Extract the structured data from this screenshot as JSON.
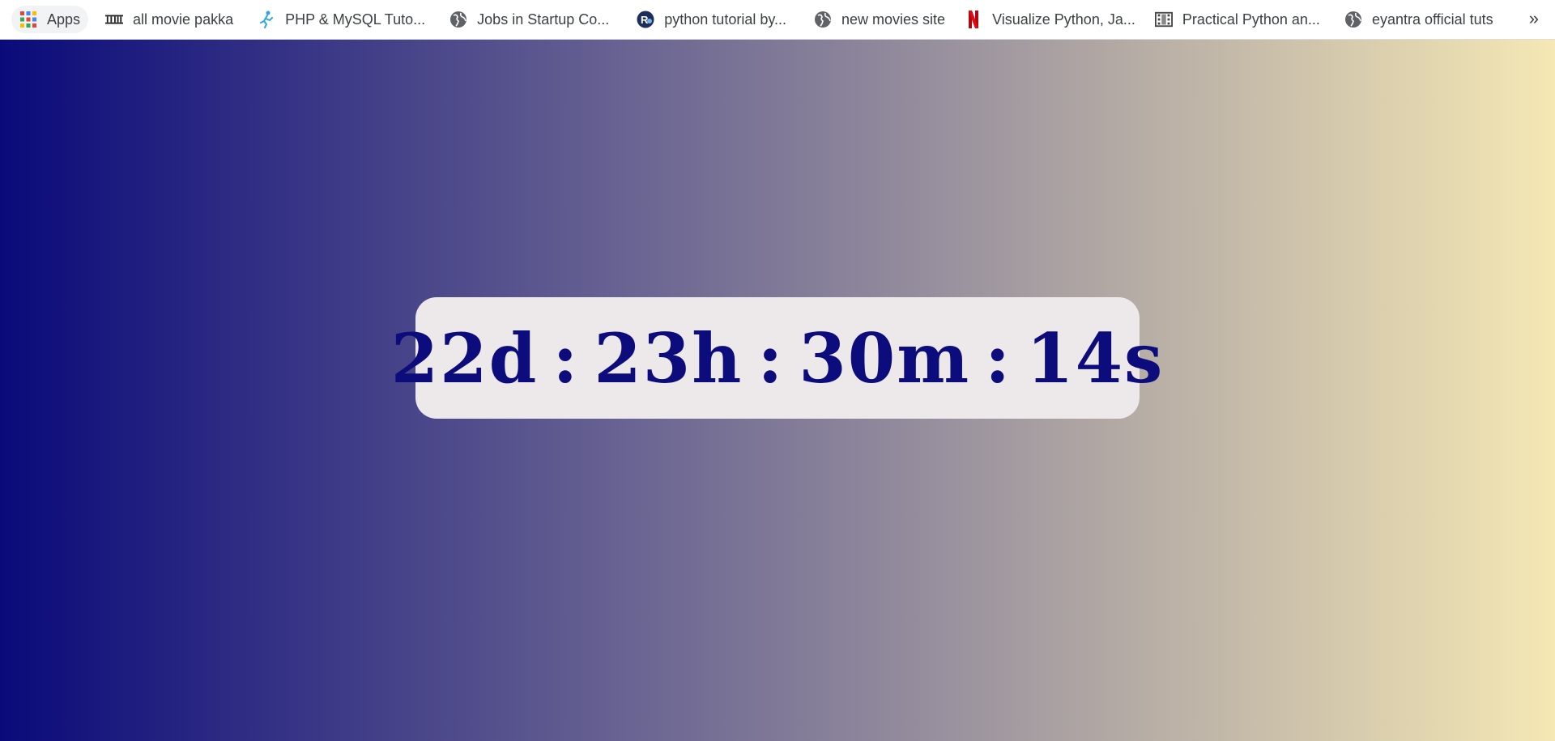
{
  "bookmarks_bar": {
    "apps": {
      "label": "Apps",
      "icon": "apps-grid-icon"
    },
    "items": [
      {
        "label": "all movie pakka",
        "icon": "movie-site-logo-icon"
      },
      {
        "label": "PHP & MySQL Tuto...",
        "icon": "runner-icon"
      },
      {
        "label": "Jobs in Startup Co...",
        "icon": "globe-icon"
      },
      {
        "label": "python tutorial by...",
        "icon": "r-logo-icon"
      },
      {
        "label": "new movies site",
        "icon": "globe-icon"
      },
      {
        "label": "Visualize Python, Ja...",
        "icon": "netflix-icon"
      },
      {
        "label": "Practical Python an...",
        "icon": "film-reel-icon"
      },
      {
        "label": "eyantra official tuts",
        "icon": "globe-icon"
      }
    ],
    "overflow_label": "»"
  },
  "page": {
    "gradient": {
      "start": "#0a0a7a",
      "end": "#f5e8b5"
    },
    "countdown": {
      "days": "22d",
      "hours": "23h",
      "minutes": "30m",
      "seconds": "14s",
      "separator": ":",
      "text_color": "#0c0c7c",
      "card_color": "#ede8e9"
    }
  }
}
